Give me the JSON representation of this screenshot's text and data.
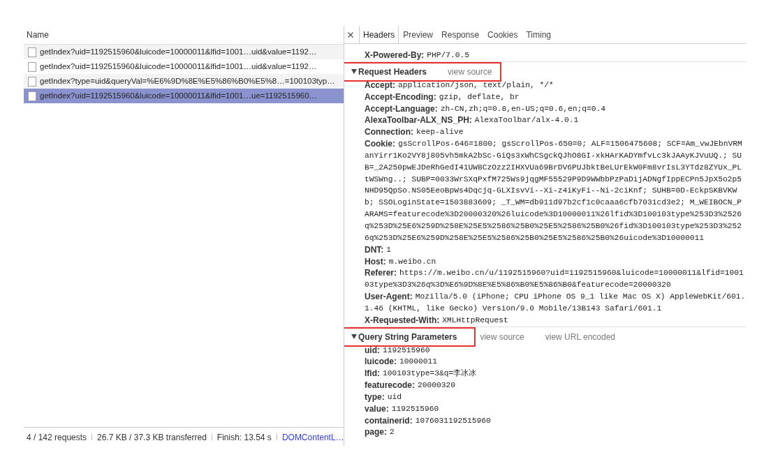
{
  "requests": {
    "column": "Name",
    "rows": [
      {
        "name": "getIndex?uid=1192515960&luicode=10000011&lfid=1001…uid&value=1192…",
        "selected": false
      },
      {
        "name": "getIndex?uid=1192515960&luicode=10000011&lfid=1001…uid&value=1192…",
        "selected": false
      },
      {
        "name": "getIndex?type=uid&queryVal=%E6%9D%8E%E5%86%B0%E5%8…=100103typ…",
        "selected": false
      },
      {
        "name": "getIndex?uid=1192515960&luicode=10000011&lfid=1001…ue=1192515960…",
        "selected": true
      }
    ]
  },
  "status_bar": {
    "items": [
      {
        "kind": "text",
        "text": "4 / 142 requests"
      },
      {
        "kind": "text",
        "text": "26.7 KB / 37.3 KB transferred"
      },
      {
        "kind": "text",
        "text": "Finish: 13.54 s"
      },
      {
        "kind": "link",
        "text": "DOMContentL…"
      }
    ]
  },
  "details": {
    "tabs": [
      {
        "label": "Headers",
        "selected": true
      },
      {
        "label": "Preview",
        "selected": false
      },
      {
        "label": "Response",
        "selected": false
      },
      {
        "label": "Cookies",
        "selected": false
      },
      {
        "label": "Timing",
        "selected": false
      }
    ],
    "sections": [
      {
        "rows": [
          {
            "name": "X-Powered-By:",
            "value": "PHP/7.0.5"
          }
        ]
      },
      {
        "title": "Request Headers",
        "expanded": true,
        "highlighted": true,
        "links": [
          {
            "label": "view source",
            "highlighted": true
          }
        ],
        "rows": [
          {
            "name": "Accept:",
            "value": "application/json, text/plain, */*"
          },
          {
            "name": "Accept-Encoding:",
            "value": "gzip, deflate, br"
          },
          {
            "name": "Accept-Language:",
            "value": "zh-CN,zh;q=0.8,en-US;q=0.6,en;q=0.4"
          },
          {
            "name": "AlexaToolbar-ALX_NS_PH:",
            "value": "AlexaToolbar/alx-4.0.1"
          },
          {
            "name": "Connection:",
            "value": "keep-alive"
          },
          {
            "name": "Cookie:",
            "value": "gsScrollPos-646=1800; gsScrollPos-650=0; ALF=1506475608; SCF=Am_vwJEbnVRManYirr1Ko2VY8j805vh5mkA2bSc-GiQs3xWhCSgckQJhO8GI-xkHArKADYmfvLc3kJAAyKJVuUQ.; SUB=_2A250pwEJDeRhGedI41UW8CzOzz2IHXVUa69BrDV6PUJbktBeLUrEkW0Fm8vrIsL3YTdz8ZYUx_PLtWSWng..; SUBP=0033WrSXqPxfM725Ws9jqgMF55529P9D9WWbbPzPaDijADNgfIppECPn5JpX5o2p5NHD95QpSo.NS05EeoBpWs4Dqcjq-GLXIsvVi--Xi-z4iKyFi--Ni-2ciKnf; SUHB=0D-EckpSKBVKWb; SSOLoginState=1503883609; _T_WM=db911d97b2cf1c0caaa6cfb7031cd3e2; M_WEIBOCN_PARAMS=featurecode%3D20000320%26luicode%3D10000011%26lfid%3D100103type%253D3%2526q%253D%25E6%259D%258E%25E5%2586%25B0%25E5%2586%25B0%26fid%3D100103type%253D3%2526q%253D%25E6%259D%258E%25E5%2586%25B0%25E5%2586%25B0%26uicode%3D10000011"
          },
          {
            "name": "DNT:",
            "value": "1"
          },
          {
            "name": "Host:",
            "value": "m.weibo.cn"
          },
          {
            "name": "Referer:",
            "value": "https://m.weibo.cn/u/1192515960?uid=1192515960&luicode=10000011&lfid=100103type%3D3%26q%3D%E6%9D%8E%E5%86%B0%E5%86%B0&featurecode=20000320"
          },
          {
            "name": "User-Agent:",
            "value": "Mozilla/5.0 (iPhone; CPU iPhone OS 9_1 like Mac OS X) AppleWebKit/601.1.46 (KHTML, like Gecko) Version/9.0 Mobile/13B143 Safari/601.1"
          },
          {
            "name": "X-Requested-With:",
            "value": "XMLHttpRequest"
          }
        ]
      },
      {
        "title": "Query String Parameters",
        "expanded": true,
        "highlighted": true,
        "links": [
          {
            "label": "view source",
            "highlighted": false
          },
          {
            "label": "view URL encoded",
            "highlighted": false
          }
        ],
        "rows": [
          {
            "name": "uid:",
            "value": "1192515960"
          },
          {
            "name": "luicode:",
            "value": "10000011"
          },
          {
            "name": "lfid:",
            "value": "100103type=3&q=李冰冰"
          },
          {
            "name": "featurecode:",
            "value": "20000320"
          },
          {
            "name": "type:",
            "value": "uid"
          },
          {
            "name": "value:",
            "value": "1192515960"
          },
          {
            "name": "containerid:",
            "value": "1076031192515960"
          },
          {
            "name": "page:",
            "value": "2"
          }
        ]
      }
    ]
  }
}
